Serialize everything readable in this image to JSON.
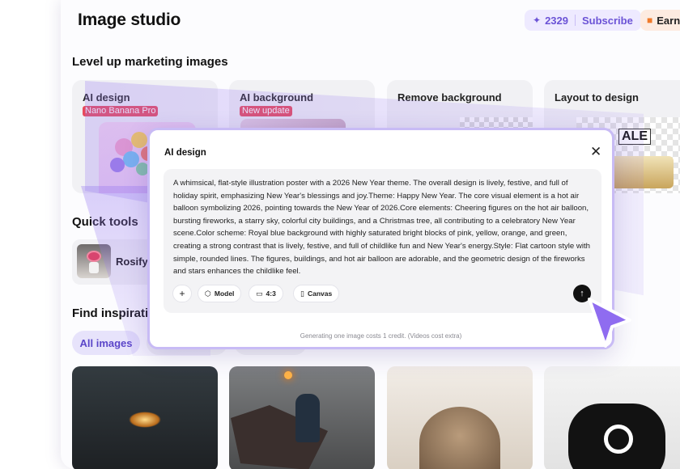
{
  "header": {
    "title": "Image studio",
    "credits": "2329",
    "subscribe_label": "Subscribe",
    "earn_label": "Earn"
  },
  "sections": {
    "marketing": "Level up marketing images",
    "quick_tools": "Quick tools",
    "inspiration": "Find inspiration"
  },
  "cards": [
    {
      "label": "AI design",
      "badge": "Nano Banana Pro",
      "badge_color": "#e8495b"
    },
    {
      "label": "AI background",
      "badge": "New update",
      "badge_color": "#e8495b"
    },
    {
      "label": "Remove background"
    },
    {
      "label": "Layout to design",
      "image_text": "ALE"
    }
  ],
  "quick_tools": [
    {
      "label": "Rosify"
    }
  ],
  "filters": {
    "active": "All images"
  },
  "modal": {
    "title": "AI design",
    "prompt": "A whimsical, flat-style illustration poster with a 2026 New Year theme. The overall design is lively, festive, and full of holiday spirit, emphasizing New Year's blessings and joy.Theme: Happy New Year. The core visual element is a hot air balloon symbolizing 2026, pointing towards the New Year of 2026.Core elements: Cheering figures on the hot air balloon, bursting fireworks, a starry sky, colorful city buildings, and a Christmas tree, all contributing to a celebratory New Year scene.Color scheme: Royal blue background with highly saturated bright blocks of pink, yellow, orange, and green, creating a strong contrast that is lively, festive, and full of childlike fun and New Year's energy.Style: Flat cartoon style with simple, rounded lines. The figures, buildings, and hot air balloon are adorable, and the geometric design of the fireworks and stars enhances the childlike feel.",
    "toolbar": {
      "add_label": "+",
      "model_label": "Model",
      "ratio_label": "4:3",
      "canvas_label": "Canvas"
    },
    "footer": "Generating one image costs 1 credit. (Videos cost extra)"
  },
  "colors": {
    "accent": "#6b53d6",
    "accent_light": "#eeeaff",
    "cursor": "#8f6cf0",
    "badge": "#e8495b"
  },
  "icons": [
    "sparkle-icon",
    "gift-icon",
    "close-icon",
    "plus-icon",
    "cube-icon",
    "aspect-ratio-icon",
    "canvas-icon",
    "arrow-up-icon",
    "pointer-cursor-icon"
  ]
}
